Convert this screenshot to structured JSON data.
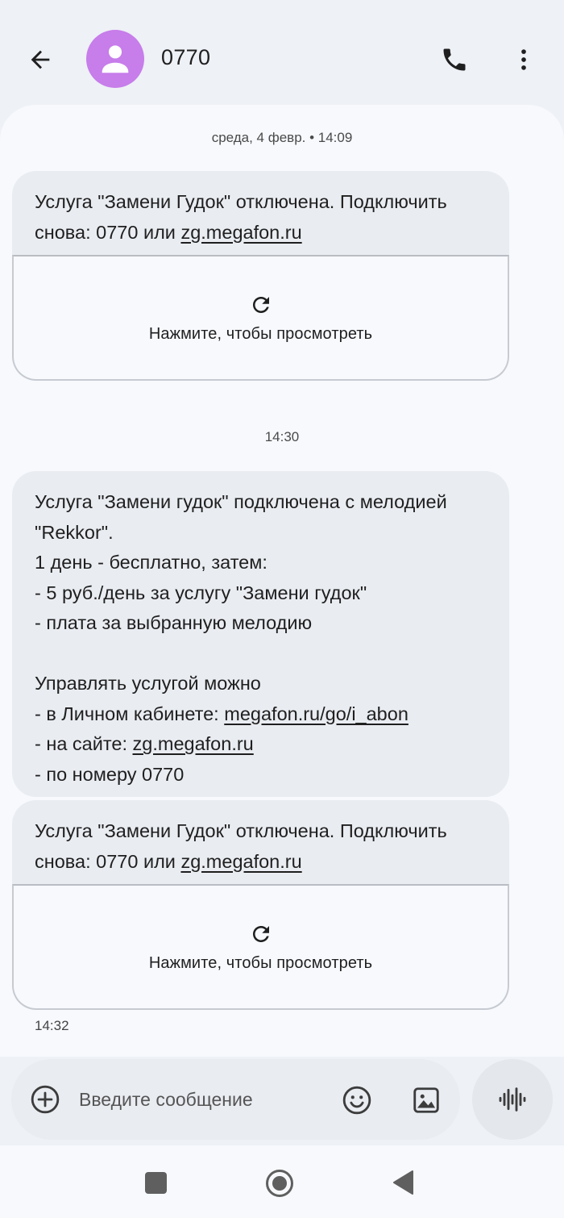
{
  "header": {
    "contact_name": "0770",
    "back_icon": "arrow-left-icon",
    "avatar_icon": "person-icon",
    "call_icon": "phone-icon",
    "menu_icon": "more-vertical-icon",
    "avatar_color": "#c77dea"
  },
  "chat": {
    "date_separator_1": "среда, 4 февр. • 14:09",
    "time_separator_2": "14:30",
    "message_1": {
      "text_before": "Услуга \"Замени Гудок\" отключена. Подключить снова: 0770 или ",
      "link": "zg.megafon.ru",
      "preview_label": "Нажмите, чтобы просмотреть",
      "preview_icon": "refresh-icon"
    },
    "message_2": {
      "line1": "Услуга \"Замени гудок\" подключена с мелодией \"Rekkor\".",
      "line2": "1 день - бесплатно, затем:",
      "line3": "- 5 руб./день за услугу \"Замени гудок\"",
      "line4": "- плата за выбранную мелодию",
      "line5": "Управлять услугой можно",
      "line6_prefix": "- в Личном кабинете: ",
      "line6_link": "megafon.ru/go/i_abon",
      "line7_prefix": "- на сайте: ",
      "line7_link": "zg.megafon.ru",
      "line8": "- по номеру 0770"
    },
    "message_3": {
      "text_before": "Услуга \"Замени Гудок\" отключена. Подключить снова: 0770 или ",
      "link": "zg.megafon.ru",
      "preview_label": "Нажмите, чтобы просмотреть",
      "preview_icon": "refresh-icon"
    },
    "last_timestamp": "14:32"
  },
  "composer": {
    "placeholder": "Введите сообщение",
    "add_icon": "add-circle-icon",
    "emoji_icon": "emoji-icon",
    "image_icon": "image-icon",
    "voice_icon": "voice-wave-icon"
  },
  "navbar": {
    "recents_icon": "square-icon",
    "home_icon": "circle-home-icon",
    "back_icon": "triangle-back-icon"
  }
}
